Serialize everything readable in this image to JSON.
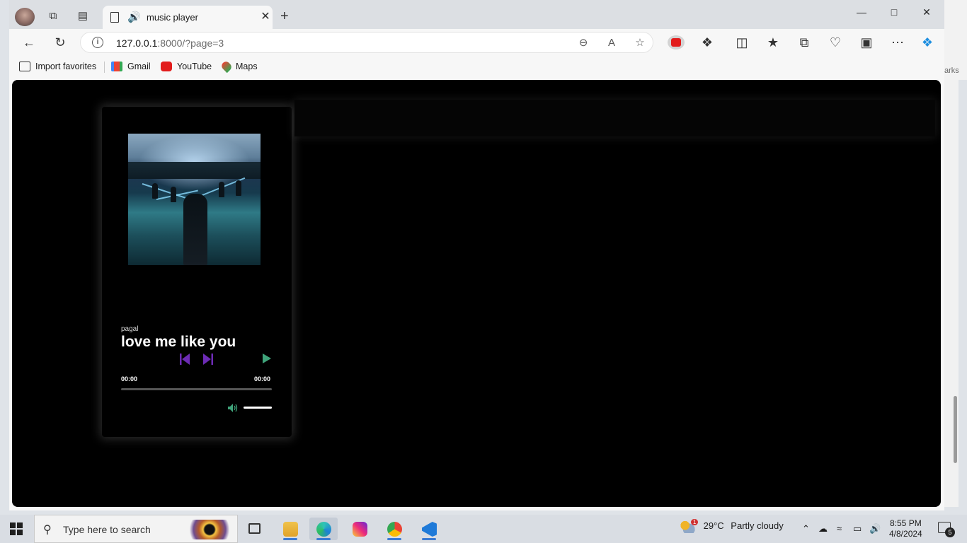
{
  "browser": {
    "tab_title": "music player",
    "new_tab": "+",
    "url_host": "127.0.0.1",
    "url_rest": ":8000/?page=3",
    "bookmarks": [
      {
        "label": "Import favorites"
      },
      {
        "label": "Gmail"
      },
      {
        "label": "YouTube"
      },
      {
        "label": "Maps"
      }
    ],
    "bookmarks_overflow": "arks"
  },
  "player": {
    "artist": "pagal",
    "song_title": "love me like you",
    "current_time": "00:00",
    "duration": "00:00",
    "progress_fraction": 0,
    "volume_fraction": 1
  },
  "taskbar": {
    "search_placeholder": "Type here to search",
    "weather_badge": "1",
    "weather_temp": "29°C",
    "weather_desc": "Partly cloudy",
    "time": "8:55 PM",
    "date": "4/8/2024",
    "notifications": "5"
  },
  "colors": {
    "accent_purple": "#6d2bb5",
    "play_green": "#3fa37a",
    "page_bg": "#000000"
  }
}
